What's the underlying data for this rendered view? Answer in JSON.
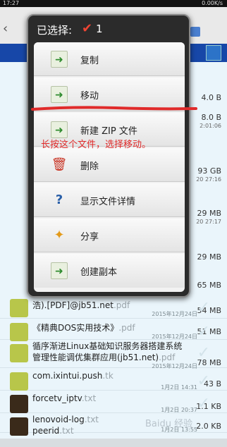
{
  "statusbar": {
    "time": "17:27",
    "signal": "0.00K/s"
  },
  "dialog": {
    "title": "已选择:",
    "count": "1",
    "items": [
      {
        "label": "复制",
        "icon": "copy-icon"
      },
      {
        "label": "移动",
        "icon": "move-icon"
      },
      {
        "label": "新建 ZIP 文件",
        "icon": "zip-icon"
      },
      {
        "label": "删除",
        "icon": "trash-icon"
      },
      {
        "label": "显示文件详情",
        "icon": "info-icon"
      },
      {
        "label": "分享",
        "icon": "share-icon"
      },
      {
        "label": "创建副本",
        "icon": "duplicate-icon"
      }
    ]
  },
  "annotation": "长按这个文件，选择移动。",
  "right_column": [
    {
      "size": "4.0 B",
      "sub": ""
    },
    {
      "size": "8.0 B",
      "sub": "2:01:06"
    },
    {
      "size": "93 GB",
      "sub": "20 27:16"
    },
    {
      "size": "29 MB",
      "sub": "20 27:17"
    },
    {
      "size": "29 MB",
      "sub": ""
    },
    {
      "size": "65 MB",
      "sub": ""
    }
  ],
  "files": [
    {
      "name": "浩).[PDF]@jb51.net",
      "ext": ".pdf",
      "date": "2015年12月24日",
      "size": "54 MB"
    },
    {
      "name": "《精典DOS实用技术》",
      "ext": ".pdf",
      "date": "2015年12月24日",
      "size": "51 MB"
    },
    {
      "name": "循序渐进Linux基础知识服务器搭建系统",
      "name2": "管理性能调优集群应用(jb51.net)",
      "ext": ".pdf",
      "date": "2015年12月24日",
      "size": "78 MB"
    },
    {
      "name": "com.ixintui.push",
      "ext": ".tk",
      "date": "1月2日 14:31",
      "size": "43 B"
    },
    {
      "name": "forcetv_iptv",
      "ext": ".txt",
      "date": "1月2日 20:37",
      "size": "1.1 KB"
    },
    {
      "name": "lenovoid-log",
      "ext": ".txt",
      "date": "1月2日 13:55",
      "size": "2.0 KB"
    },
    {
      "name": "peerid",
      "ext": ".txt",
      "date": "",
      "size": ""
    }
  ],
  "watermark": "Baidu 经验"
}
